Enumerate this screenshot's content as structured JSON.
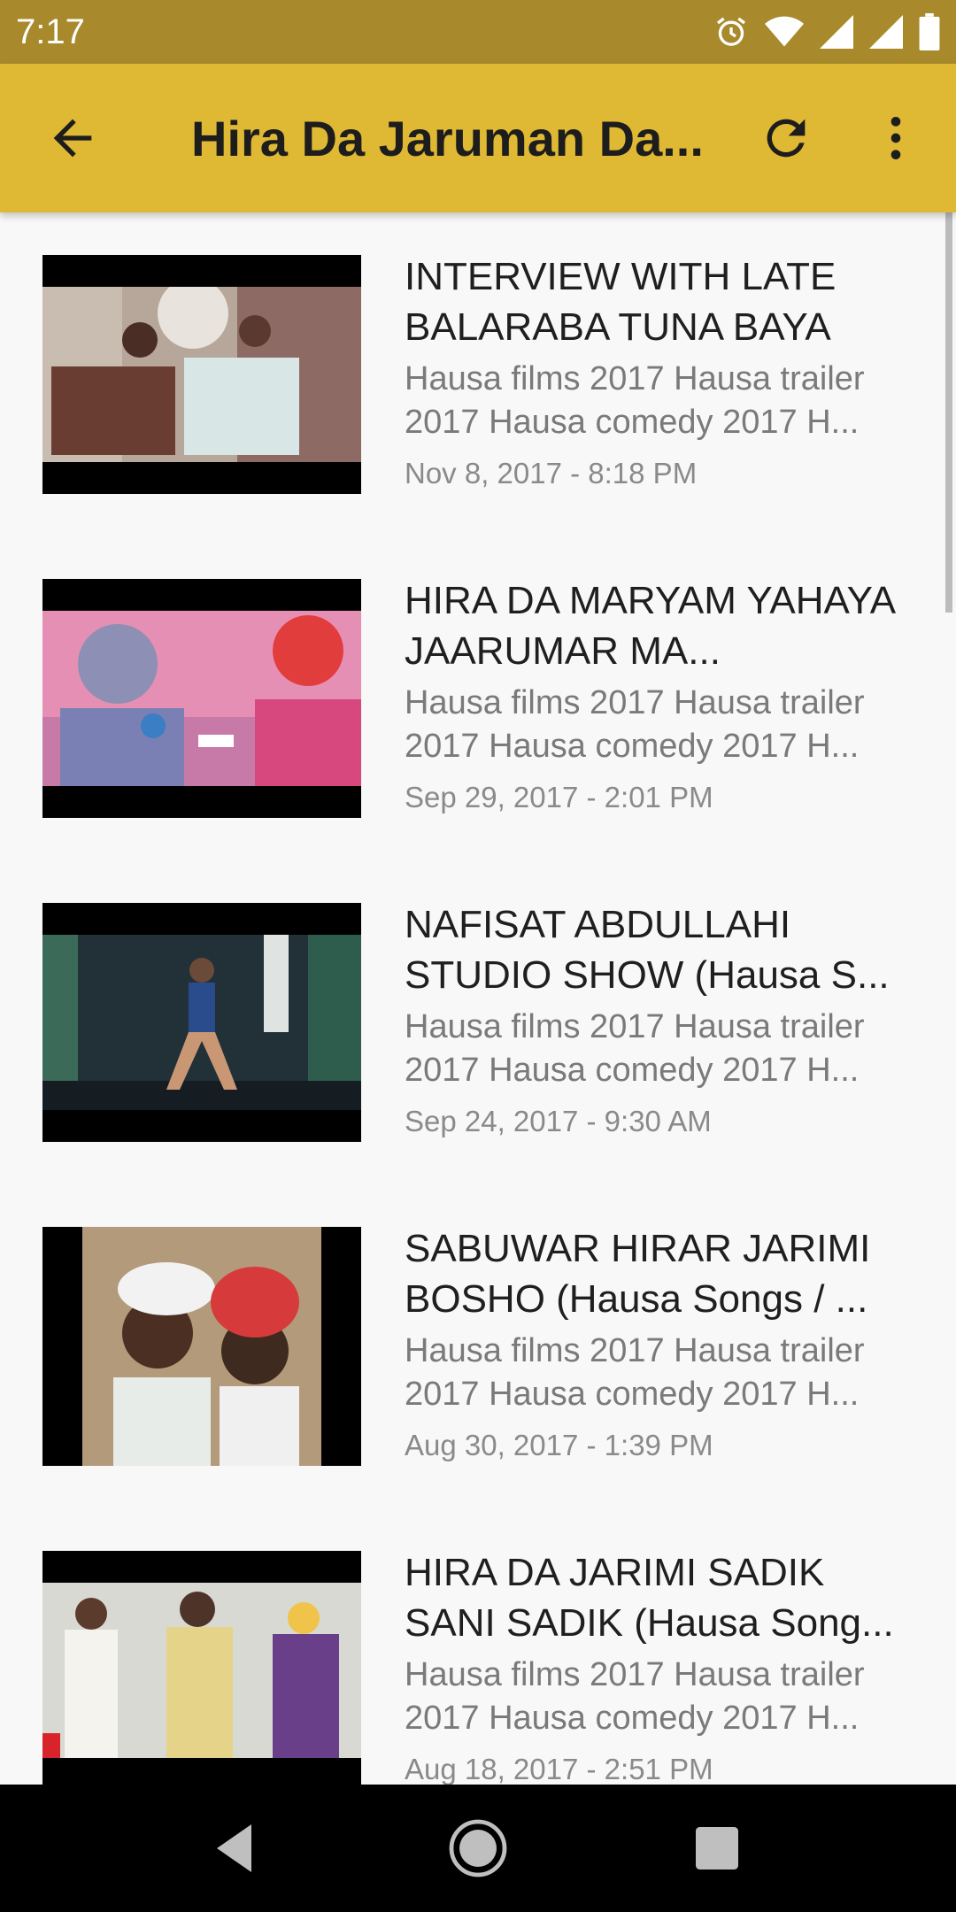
{
  "status_bar": {
    "time": "7:17",
    "icons": [
      "alarm-icon",
      "wifi-icon",
      "signal-icon",
      "signal-icon",
      "battery-icon"
    ]
  },
  "app_bar": {
    "title": "Hira Da Jaruman Da...",
    "back_icon": "arrow-back-icon",
    "refresh_icon": "refresh-icon",
    "more_icon": "more-vert-icon",
    "background_color": "#e0b934"
  },
  "videos": [
    {
      "title": "INTERVIEW WITH LATE BALARABA TUNA BAYA",
      "description": "Hausa films 2017 Hausa trailer 2017 Hausa comedy 2017 H...",
      "date": "Nov 8, 2017 - 8:18 PM"
    },
    {
      "title": "HIRA DA MARYAM YAHAYA JAARUMAR MA...",
      "description": "Hausa films 2017 Hausa trailer 2017 Hausa comedy 2017 H...",
      "date": "Sep 29, 2017 - 2:01 PM"
    },
    {
      "title": "NAFISAT ABDULLAHI STUDIO SHOW (Hausa S...",
      "description": "Hausa films 2017 Hausa trailer 2017 Hausa comedy 2017 H...",
      "date": "Sep 24, 2017 - 9:30 AM"
    },
    {
      "title": "SABUWAR HIRAR JARIMI BOSHO (Hausa Songs / ...",
      "description": "Hausa films 2017 Hausa trailer 2017 Hausa comedy 2017 H...",
      "date": "Aug 30, 2017 - 1:39 PM"
    },
    {
      "title": "HIRA DA JARIMI SADIK SANI SADIK (Hausa Song...",
      "description": "Hausa films 2017 Hausa trailer 2017 Hausa comedy 2017 H...",
      "date": "Aug 18, 2017 - 2:51 PM"
    }
  ],
  "nav_bar": {
    "icons": [
      "back-triangle-icon",
      "home-circle-icon",
      "recents-square-icon"
    ]
  }
}
